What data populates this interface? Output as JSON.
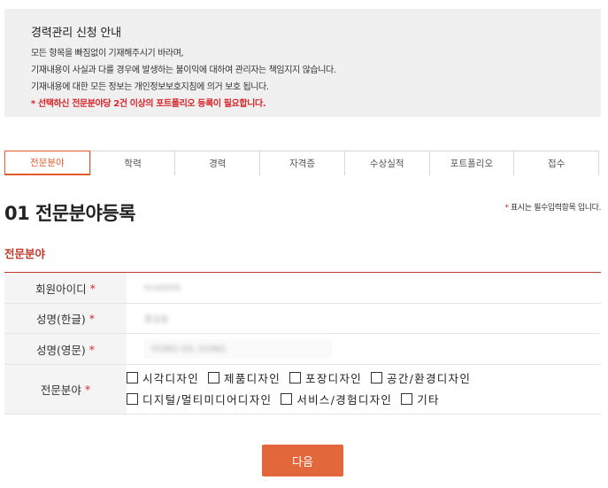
{
  "notice": {
    "title": "경력관리 신청 안내",
    "lines": [
      "모든 항목을 빠짐없이 기재해주시기 바라며,",
      "기재내용이 사실과 다를 경우에 발생하는 불이익에 대하여 관리자는 책임지지 않습니다.",
      "기재내용에 대한 모든 정보는 개인정보보호지침에 의거 보호 됩니다."
    ],
    "warning": "* 선택하신 전문분야당 2건 이상의 포트폴리오 등록이 필요합니다."
  },
  "tabs": [
    "전문분야",
    "학력",
    "경력",
    "자격증",
    "수상실적",
    "포트폴리오",
    "접수"
  ],
  "active_tab": "전문분야",
  "section": {
    "title": "01 전문분야등록",
    "required_star": "*",
    "required_note": "표시는 필수입력항목 입니다."
  },
  "field_group_title": "전문분야",
  "form": {
    "member_id": {
      "label": "회원아이디",
      "star": "*",
      "value": "hrs0000"
    },
    "name_ko": {
      "label": "성명(한글)",
      "star": "*",
      "value": "홍길동"
    },
    "name_en": {
      "label": "성명(영문)",
      "star": "*",
      "value": "HONG GIL DONG"
    },
    "specialty": {
      "label": "전문분야",
      "star": "*",
      "options_row1": [
        "시각디자인",
        "제품디자인",
        "포장디자인",
        "공간/환경디자인"
      ],
      "options_row2": [
        "디지털/멀티미디어디자인",
        "서비스/경험디자인",
        "기타"
      ]
    }
  },
  "next_button": "다음",
  "colors": {
    "accent": "#e2673a",
    "required": "#d8262b",
    "notice_bg": "#f0f0f0"
  }
}
